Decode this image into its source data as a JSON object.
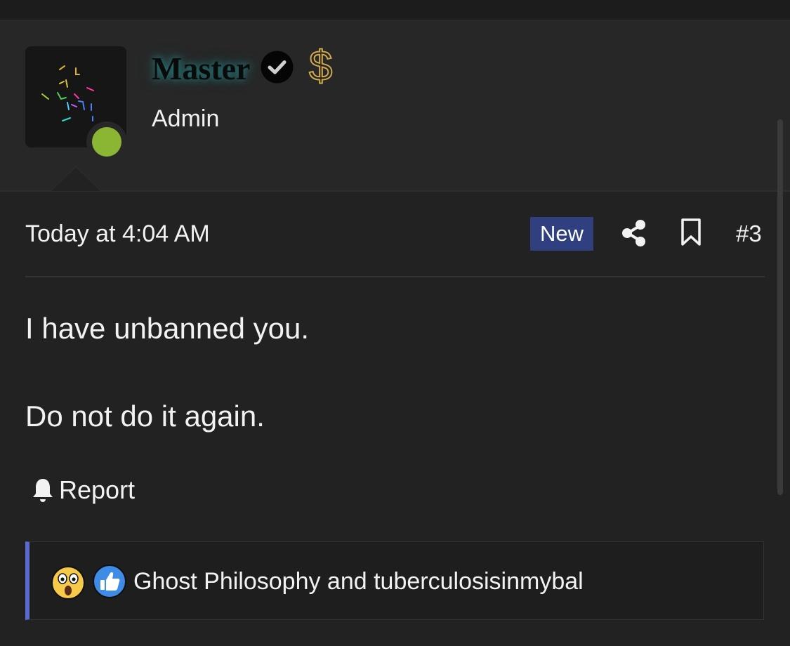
{
  "post": {
    "author": {
      "name": "Master",
      "role": "Admin",
      "status": "online",
      "badges": [
        "verified-icon",
        "dollar-icon"
      ],
      "dollar_glyph": "$"
    },
    "date": "Today at 4:04 AM",
    "badge": "New",
    "number": "#3",
    "body": [
      "I have unbanned you.",
      "Do not do it again."
    ],
    "report_label": "Report",
    "reactions": {
      "icons": [
        "wow-emoji-icon",
        "like-emoji-icon"
      ],
      "text": "Ghost Philosophy and tuberculosisinmybal"
    }
  },
  "colors": {
    "background": "#222222",
    "header": "#272727",
    "online": "#8bb634",
    "new_badge": "#2f3f7f",
    "reaction_accent": "#5c6ad0",
    "dollar_gold": "#cdaa56"
  }
}
